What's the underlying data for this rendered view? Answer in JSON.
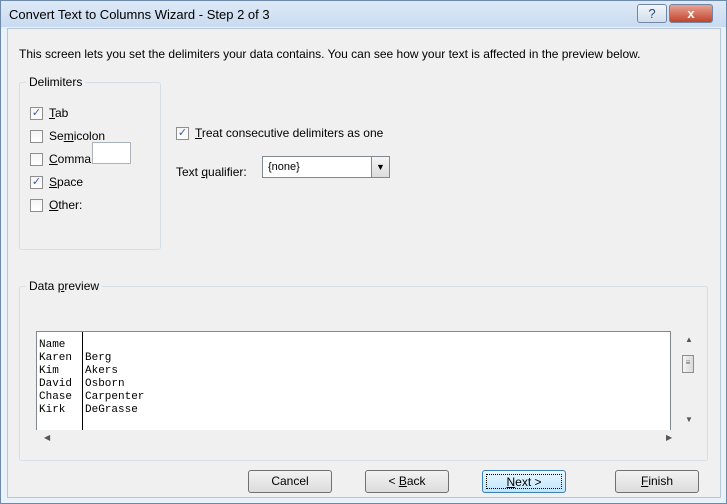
{
  "window": {
    "title": "Convert Text to Columns Wizard - Step 2 of 3",
    "help_icon": "?",
    "close_icon": "x"
  },
  "description": "This screen lets you set the delimiters your data contains.  You can see how your text is affected in the preview below.",
  "delimiters": {
    "label": "Delimiters",
    "tab": {
      "mn": "T",
      "rest": "ab",
      "checked": true
    },
    "semicolon": {
      "pre": "Se",
      "mn": "m",
      "rest": "icolon",
      "checked": false
    },
    "comma": {
      "mn": "C",
      "rest": "omma",
      "checked": false
    },
    "space": {
      "mn": "S",
      "rest": "pace",
      "checked": true
    },
    "other": {
      "mn": "O",
      "rest": "ther:",
      "checked": false,
      "value": ""
    }
  },
  "consecutive": {
    "mn": "T",
    "rest": "reat consecutive delimiters as one",
    "checked": true
  },
  "qualifier": {
    "pre": "Text ",
    "mn": "q",
    "rest": "ualifier:",
    "value": "{none}"
  },
  "preview": {
    "label_pre": "Data ",
    "label_mn": "p",
    "label_rest": "review",
    "rows": [
      [
        "Name",
        ""
      ],
      [
        "Karen",
        "Berg"
      ],
      [
        "Kim",
        "Akers"
      ],
      [
        "David",
        "Osborn"
      ],
      [
        "Chase",
        "Carpenter"
      ],
      [
        "Kirk",
        "DeGrasse"
      ]
    ]
  },
  "buttons": {
    "cancel": "Cancel",
    "back_pre": "< ",
    "back_mn": "B",
    "back_rest": "ack",
    "next_mn": "N",
    "next_rest": "ext >",
    "finish_mn": "F",
    "finish_rest": "inish"
  },
  "check_glyph": "✓",
  "icons": {
    "combo_arrow": "▼",
    "up_arrow": "▲",
    "down_arrow": "▼",
    "left_arrow": "◀",
    "right_arrow": "▶",
    "grip": "≡"
  }
}
